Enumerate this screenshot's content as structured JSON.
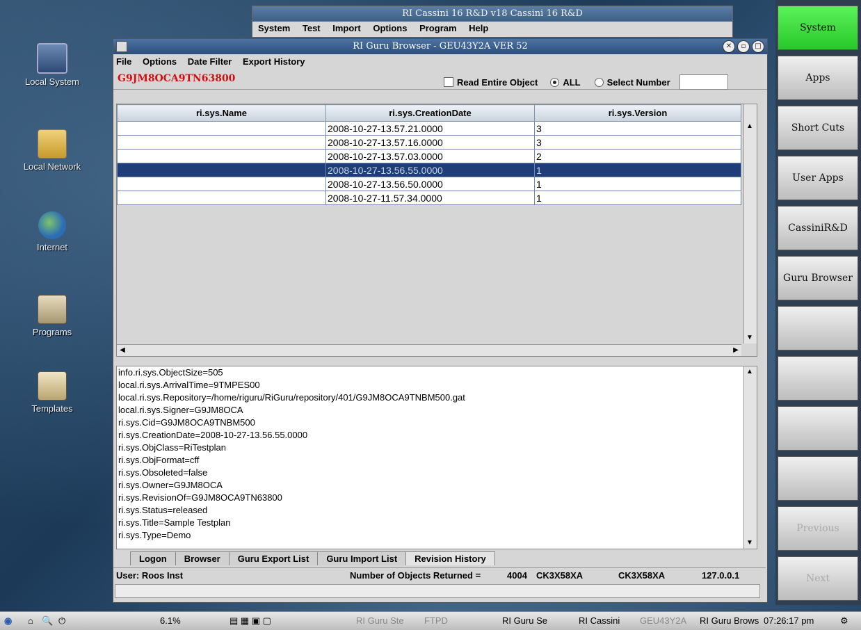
{
  "desktop": {
    "icons": [
      {
        "label": "Local System"
      },
      {
        "label": "Local Network"
      },
      {
        "label": "Internet"
      },
      {
        "label": "Programs"
      },
      {
        "label": "Templates"
      }
    ]
  },
  "background_window": {
    "title": "RI Cassini 16 R&D v18  Cassini 16 R&D",
    "menu": [
      "System",
      "Test",
      "Import",
      "Options",
      "Program",
      "Help"
    ]
  },
  "window": {
    "title": "RI Guru Browser - GEU43Y2A  VER 52",
    "menu": [
      "File",
      "Options",
      "Date Filter",
      "Export History"
    ],
    "object_id": "G9JM8OCA9TN63800",
    "read_entire_label": "Read Entire Object",
    "all_label": "ALL",
    "select_number_label": "Select Number",
    "table": {
      "headers": [
        "ri.sys.Name",
        "ri.sys.CreationDate",
        "ri.sys.Version"
      ],
      "rows": [
        {
          "name": "",
          "date": "2008-10-27-13.57.21.0000",
          "version": "3"
        },
        {
          "name": "",
          "date": "2008-10-27-13.57.16.0000",
          "version": "3"
        },
        {
          "name": "",
          "date": "2008-10-27-13.57.03.0000",
          "version": "2"
        },
        {
          "name": "",
          "date": "2008-10-27-13.56.55.0000",
          "version": "1"
        },
        {
          "name": "",
          "date": "2008-10-27-13.56.50.0000",
          "version": "1"
        },
        {
          "name": "",
          "date": "2008-10-27-11.57.34.0000",
          "version": "1"
        }
      ],
      "selected_row": 3
    },
    "properties": [
      "info.ri.sys.ObjectSize=505",
      "local.ri.sys.ArrivalTime=9TMPES00",
      "local.ri.sys.Repository=/home/riguru/RiGuru/repository/401/G9JM8OCA9TNBM500.gat",
      "local.ri.sys.Signer=G9JM8OCA",
      "ri.sys.Cid=G9JM8OCA9TNBM500",
      "ri.sys.CreationDate=2008-10-27-13.56.55.0000",
      "ri.sys.ObjClass=RiTestplan",
      "ri.sys.ObjFormat=cff",
      "ri.sys.Obsoleted=false",
      "ri.sys.Owner=G9JM8OCA",
      "ri.sys.RevisionOf=G9JM8OCA9TN63800",
      "ri.sys.Status=released",
      "ri.sys.Title=Sample Testplan",
      "ri.sys.Type=Demo"
    ],
    "tabs": [
      "Logon",
      "Browser",
      "Guru Export List",
      "Guru Import List",
      "Revision History"
    ],
    "active_tab": "Revision History",
    "status": {
      "user": "User:  Roos Inst",
      "objects_returned": "Number of Objects Returned = ",
      "count": "4004",
      "field1": "CK3X58XA",
      "field2": "CK3X58XA",
      "ip": "127.0.0.1"
    }
  },
  "right_panel": {
    "buttons": [
      "System",
      "Apps",
      "Short Cuts",
      "User Apps",
      "CassiniR&D",
      "Guru Browser",
      "",
      "",
      "",
      "",
      "Previous",
      "Next"
    ]
  },
  "taskbar": {
    "cpu": "6.1%",
    "items": [
      "RI Guru Ste",
      "FTPD",
      "RI Guru Se",
      "RI Cassini",
      "GEU43Y2A",
      "RI Guru Brows"
    ],
    "clock": "07:26:17 pm"
  },
  "colors": {
    "object_id": "#d01010",
    "selected_row": "#1f3d78",
    "system_button": "#3ee03e",
    "titlebar": "#3b5f8f"
  }
}
